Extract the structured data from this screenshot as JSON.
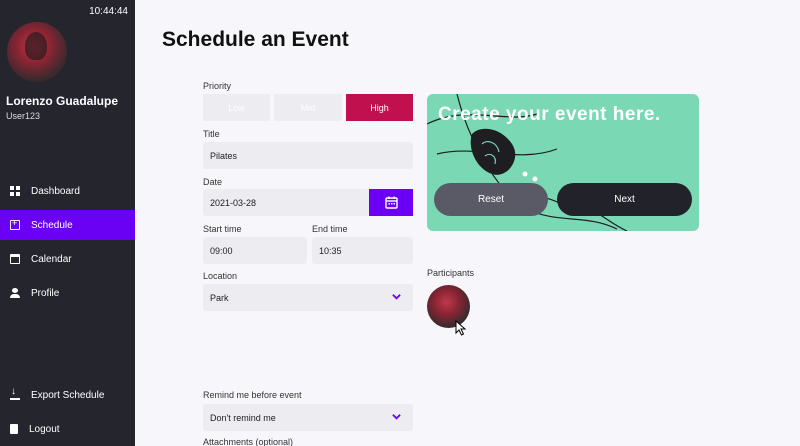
{
  "clock": "10:44:44",
  "user": {
    "name": "Lorenzo Guadalupe",
    "handle": "User123"
  },
  "nav": {
    "dashboard": "Dashboard",
    "schedule": "Schedule",
    "calendar": "Calendar",
    "profile": "Profile",
    "export": "Export Schedule",
    "logout": "Logout"
  },
  "page_title": "Schedule an Event",
  "form": {
    "priority_label": "Priority",
    "priority_options": [
      "Low",
      "Mid",
      "High"
    ],
    "priority_selected": "High",
    "title_label": "Title",
    "title_value": "Pilates",
    "date_label": "Date",
    "date_value": "2021-03-28",
    "start_label": "Start time",
    "start_value": "09:00",
    "end_label": "End time",
    "end_value": "10:35",
    "location_label": "Location",
    "location_value": "Park",
    "remind_label": "Remind me before event",
    "remind_value": "Don't remind me",
    "attachments_label": "Attachments (optional)"
  },
  "banner": {
    "title": "Create your event here.",
    "reset": "Reset",
    "next": "Next"
  },
  "participants_label": "Participants",
  "colors": {
    "accent": "#6a00f4",
    "priority_high": "#c0114e",
    "banner_bg": "#7ad8b4",
    "sidebar_bg": "#25252d"
  }
}
